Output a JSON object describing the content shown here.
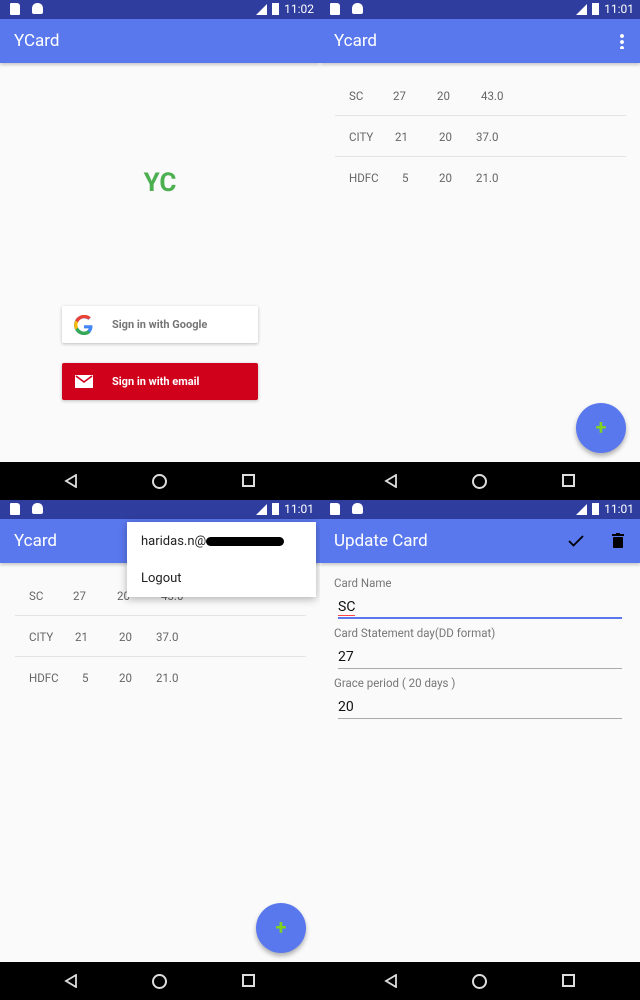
{
  "colors": {
    "status_bar": "#2f3d9e",
    "app_bar": "#5a78ee",
    "logo": "#4caf50",
    "email_button": "#d0021b",
    "fab_plus": "#7ed321"
  },
  "screens": [
    {
      "time": "11:02",
      "title": "YCard",
      "logo": "YC",
      "google_button": "Sign in with Google",
      "email_button": "Sign in with email",
      "icons": [
        "google-icon",
        "mail-icon"
      ]
    },
    {
      "time": "11:01",
      "title": "Ycard",
      "menu_icon": "more-vert-icon",
      "fab_icon": "plus-icon",
      "rows": [
        [
          "SC",
          "27",
          "20",
          "43.0"
        ],
        [
          "CITY",
          "21",
          "20",
          "37.0"
        ],
        [
          "HDFC",
          "5",
          "20",
          "21.0"
        ]
      ]
    },
    {
      "time": "11:01",
      "title": "Ycard",
      "menu": {
        "email": "haridas.n@",
        "logout": "Logout"
      },
      "fab_icon": "plus-icon",
      "rows": [
        [
          "SC",
          "27",
          "20",
          "43.0"
        ],
        [
          "CITY",
          "21",
          "20",
          "37.0"
        ],
        [
          "HDFC",
          "5",
          "20",
          "21.0"
        ]
      ]
    },
    {
      "time": "11:01",
      "title": "Update Card",
      "icons": [
        "check-icon",
        "delete-icon"
      ],
      "fields": [
        {
          "label": "Card Name",
          "value": "SC"
        },
        {
          "label": "Card Statement day(DD format)",
          "value": "27"
        },
        {
          "label": "Grace period ( 20 days )",
          "value": "20"
        }
      ]
    }
  ]
}
